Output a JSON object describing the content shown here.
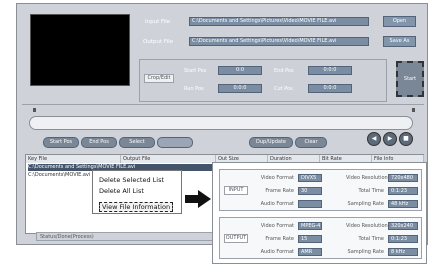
{
  "files": {
    "input_label": "Input File",
    "output_label": "Output File",
    "input_path": "C:\\Documents and Settings\\Pictures\\Video\\MOVIE FILE.avi",
    "output_path": "C:\\Documents and Settings\\Pictures\\Video\\MOVIE FILE.avi",
    "open_label": "Open",
    "save_label": "Save As"
  },
  "controls": {
    "label": "Crop/Edit",
    "rows": [
      {
        "left_label": "Start Pos",
        "left_value": "0:0",
        "right_label": "End Pos",
        "right_value": "0:0:0"
      },
      {
        "left_label": "Run Pos",
        "left_value": "0:0:0",
        "right_label": "Cut Pos",
        "right_value": "0:0:0"
      }
    ],
    "start_label": "Start"
  },
  "transport": {
    "tabs": [
      "Start Pos",
      "End Pos",
      "Select",
      "",
      "Dup/Update",
      "Clear"
    ],
    "round": [
      "◀",
      "▶",
      "■"
    ]
  },
  "list": {
    "headers": [
      "Key File",
      "Output File",
      "Out Size",
      "Duration",
      "Bit Rate",
      "File Info"
    ],
    "rows": [
      {
        "text": "C:\\Documents and Settings\\MOVIE FILE.avi"
      },
      {
        "text": "C:\\Documents\\MOVIE.avi"
      }
    ]
  },
  "context_menu": {
    "items": [
      "Delete Selected List",
      "Delete All List",
      "View File Information"
    ]
  },
  "status": {
    "text": "Status/Done(Process)"
  },
  "info": {
    "input": {
      "tag": "INPUT",
      "fields": [
        {
          "label": "Video Format",
          "value": "DIVX5"
        },
        {
          "label": "Video Resolution",
          "value": "720x480"
        },
        {
          "label": "Frame Rate",
          "value": "30"
        },
        {
          "label": "Total Time",
          "value": "0:1:23"
        },
        {
          "label": "Audio Format",
          "value": ""
        },
        {
          "label": "Sampling Rate",
          "value": "48 kHz"
        }
      ]
    },
    "output": {
      "tag": "OUTPUT",
      "fields": [
        {
          "label": "Video Format",
          "value": "MPEG-4"
        },
        {
          "label": "Video Resolution",
          "value": "320x240"
        },
        {
          "label": "Frame Rate",
          "value": "15"
        },
        {
          "label": "Total Time",
          "value": "0:1:23"
        },
        {
          "label": "Audio Format",
          "value": "AMR"
        },
        {
          "label": "Sampling Rate",
          "value": "8 kHz"
        }
      ]
    }
  }
}
